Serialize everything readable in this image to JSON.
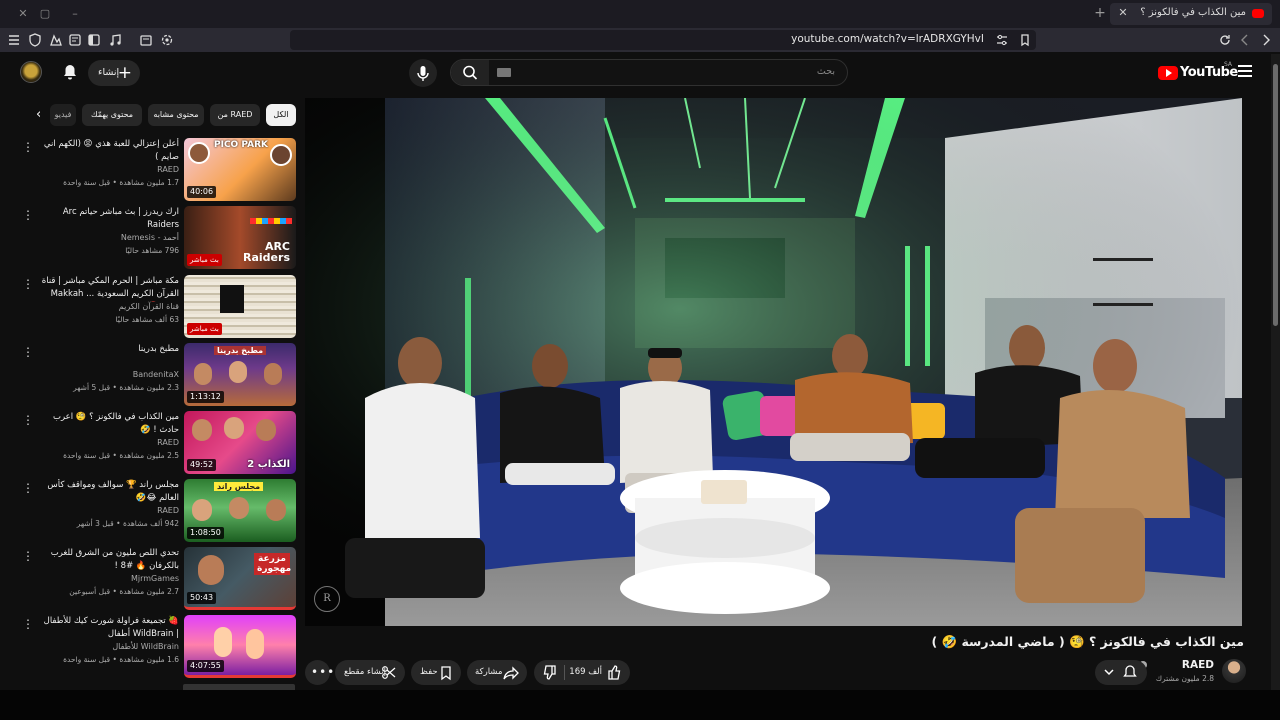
{
  "browser": {
    "tab_title": "مين الكذاب في فالكونز ؟ 🧐 ( ماض",
    "url": "youtube.com/watch?v=lrADRXGYHvI",
    "nav_icons": [
      "menu-icon",
      "shield-icon",
      "extensions-icon",
      "reader-icon",
      "sidebar-icon",
      "music-icon",
      "screenshot-icon",
      "settings-icon",
      "triangle-warning-icon",
      "brave-shield-icon",
      "undo-icon",
      "cast-icon",
      "tune-icon",
      "bookmark-icon",
      "reload-icon",
      "back-icon",
      "forward-icon"
    ]
  },
  "masthead": {
    "create_label": "إنشاء",
    "search_placeholder": "بحث",
    "logo_text": "YouTube",
    "logo_country": "SA",
    "accent_color": "#ff0000"
  },
  "chips": [
    "الكل",
    "من RAED",
    "محتوى مشابه",
    "محتوى يهمّك",
    "فيديو"
  ],
  "recommended": [
    {
      "title": "أعلن إعتزالي للعبة هذي 😡 (الكهم اني صايم )",
      "channel": "RAED",
      "meta": "1.7 مليون مشاهدة • قبل سنة واحدة",
      "duration": "40:06",
      "thumb_text": "PICO PARK"
    },
    {
      "title": "ارك ريدرز | بث مباشر حياتم Arc Raiders",
      "channel": "أحمد - Nemesis",
      "meta": "796 مشاهد حاليًا",
      "duration": "بث مباشر",
      "thumb_text": "ARC Raiders",
      "live": true
    },
    {
      "title": "مكة مباشر | الحرم المكي مباشر | قناة القرآن الكريم السعودية ... Makkah Live 🔴",
      "channel": "قناة القرآن الكريم",
      "meta": "63 ألف مشاهد حاليًا",
      "duration": "بث مباشر",
      "thumb_text": "",
      "live": true
    },
    {
      "title": "مطبخ بدرينا",
      "channel": "BandenitaX",
      "meta": "2.3 مليون مشاهدة • قبل 5 أشهر",
      "duration": "1:13:12",
      "thumb_text": "مطبخ بدرينا"
    },
    {
      "title": "مين الكذاب في فالكونز ؟ 🧐 اعرب حادث ! 🤣",
      "channel": "RAED",
      "meta": "2.5 مليون مشاهدة • قبل سنة واحدة",
      "duration": "49:52",
      "thumb_text": "الكذاب 2"
    },
    {
      "title": "مجلس راند 🏆 سوالف ومواقف كأس العالم 😂🤣",
      "channel": "RAED",
      "meta": "942 ألف مشاهدة • قبل 3 أشهر",
      "duration": "1:08:50",
      "thumb_text": "مجلس راند"
    },
    {
      "title": "تحدي اللص مليون من الشرق للغرب بالكرفان 🔥 #8 !",
      "channel": "MjrmGames",
      "meta": "2.7 مليون مشاهدة • قبل أسبوعين",
      "duration": "50:43",
      "thumb_text": "مزرعة مهجورة"
    },
    {
      "title": "🍓 تجميعة فراولة شورت كيك للأطفال | WildBrain أطفال",
      "channel": "WildBrain للأطفال",
      "meta": "1.6 مليون مشاهدة • قبل سنة واحدة",
      "duration": "4:07:55",
      "thumb_text": ""
    }
  ],
  "video": {
    "title": "مين الكذاب في فالكونز ؟ 🧐 ( ماضي المدرسة 🤣 )",
    "watermark": "R",
    "channel_name": "RAED",
    "channel_subs": "2.8 مليون مشترك",
    "like_count": "169 ألف",
    "share_label": "مشاركة",
    "save_label": "حفظ",
    "clip_label": "إنشاء مقطع"
  }
}
